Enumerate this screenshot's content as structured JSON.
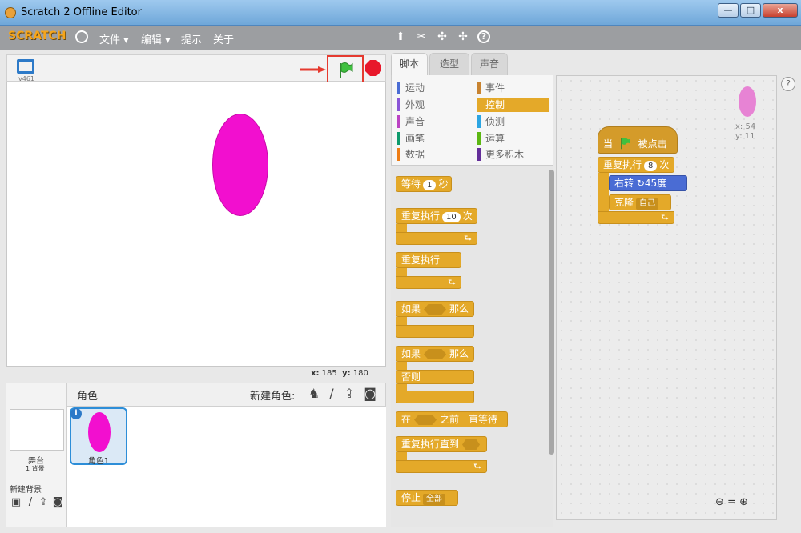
{
  "window": {
    "title": "Scratch 2 Offline Editor",
    "min_label": "—",
    "max_label": "□",
    "close_label": "x"
  },
  "menubar": {
    "logo": "SCRATCH",
    "file": "文件 ▾",
    "edit": "编辑 ▾",
    "tips": "提示",
    "about": "关于"
  },
  "stage": {
    "version": "v461",
    "x_label": "x:",
    "x_value": "185",
    "y_label": "y:",
    "y_value": "180"
  },
  "sprites": {
    "title": "角色",
    "new_sprite_label": "新建角色:",
    "stage_label": "舞台",
    "backdrop_count": "1 背景",
    "new_backdrop_label": "新建背景",
    "sprite1_name": "角色1"
  },
  "tabs": {
    "scripts": "脚本",
    "costumes": "造型",
    "sounds": "声音"
  },
  "categories": {
    "motion": "运动",
    "looks": "外观",
    "sound": "声音",
    "pen": "画笔",
    "data": "数据",
    "events": "事件",
    "control": "控制",
    "sensing": "侦测",
    "operators": "运算",
    "more": "更多积木"
  },
  "palette": {
    "wait": "等待",
    "wait_num": "1",
    "wait_unit": "秒",
    "repeat": "重复执行",
    "repeat_num": "10",
    "repeat_unit": "次",
    "forever": "重复执行",
    "if_label": "如果",
    "then_label": "那么",
    "if2_label": "如果",
    "then2_label": "那么",
    "else_label": "否则",
    "wait_until_pre": "在",
    "wait_until_post": "之前一直等待",
    "repeat_until": "重复执行直到",
    "stop": "停止",
    "stop_option": "全部",
    "loop_arrow": "⮑"
  },
  "script_area": {
    "hat_pre": "当",
    "hat_post": "被点击",
    "repeat_label": "重复执行",
    "repeat_num": "8",
    "repeat_unit": "次",
    "turn_label": "右转",
    "turn_arrow": "↻",
    "turn_num": "45",
    "turn_unit": "度",
    "clone_label": "克隆",
    "clone_option": "自己",
    "loop_arrow": "⮑",
    "x_readout": "x: 54",
    "y_readout": "y: 11",
    "help": "?"
  },
  "colors": {
    "control": "#e4a929",
    "motion": "#4a6cd4",
    "events": "#d49b2a",
    "sprite": "#f20fcf",
    "highlight": "#e53a2f"
  }
}
